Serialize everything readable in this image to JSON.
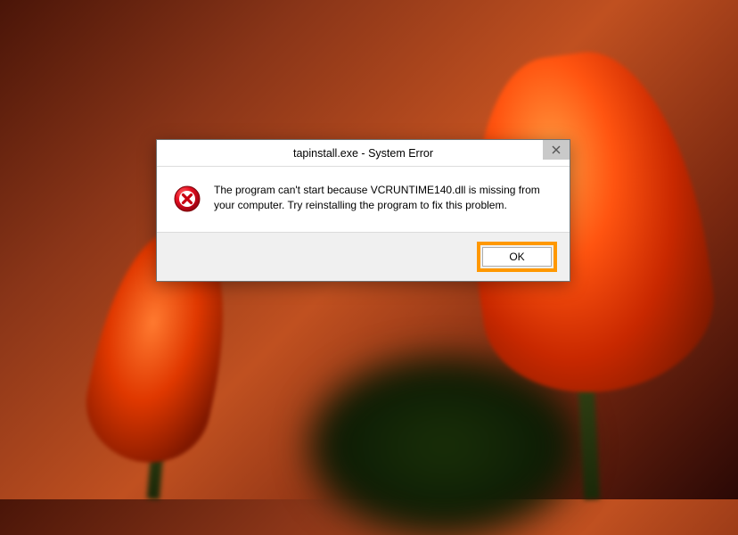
{
  "dialog": {
    "title": "tapinstall.exe - System Error",
    "message": "The program can't start because VCRUNTIME140.dll is missing from your computer. Try reinstalling the program to fix this problem.",
    "ok_label": "OK"
  }
}
